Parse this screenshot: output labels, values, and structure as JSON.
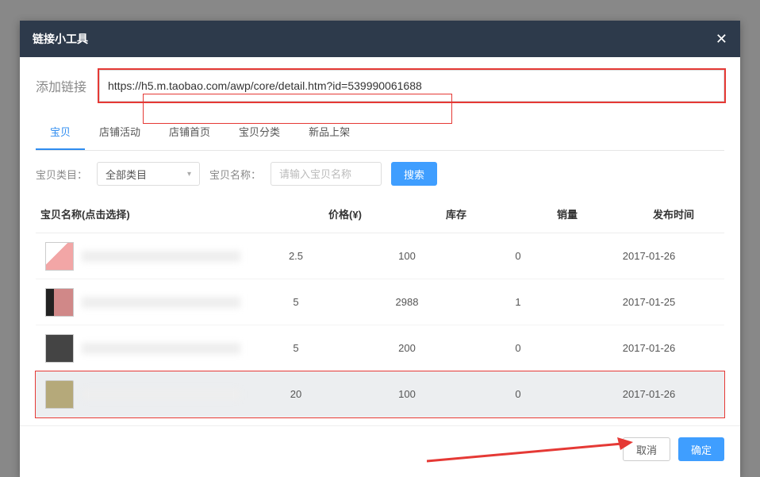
{
  "modal": {
    "title": "链接小工具"
  },
  "addLink": {
    "label": "添加链接",
    "value": "https://h5.m.taobao.com/awp/core/detail.htm?id=539990061688"
  },
  "tabs": [
    "宝贝",
    "店铺活动",
    "店铺首页",
    "宝贝分类",
    "新品上架"
  ],
  "activeTab": 0,
  "filters": {
    "categoryLabel": "宝贝类目：",
    "categoryValue": "全部类目",
    "nameLabel": "宝贝名称：",
    "namePlaceholder": "请输入宝贝名称",
    "searchLabel": "搜索"
  },
  "table": {
    "headers": {
      "name": "宝贝名称(点击选择)",
      "price": "价格(¥)",
      "stock": "库存",
      "sales": "销量",
      "date": "发布时间"
    },
    "rows": [
      {
        "price": "2.5",
        "stock": "100",
        "sales": "0",
        "date": "2017-01-26",
        "selected": false
      },
      {
        "price": "5",
        "stock": "2988",
        "sales": "1",
        "date": "2017-01-25",
        "selected": false
      },
      {
        "price": "5",
        "stock": "200",
        "sales": "0",
        "date": "2017-01-26",
        "selected": false
      },
      {
        "price": "20",
        "stock": "100",
        "sales": "0",
        "date": "2017-01-26",
        "selected": true
      }
    ]
  },
  "footer": {
    "cancel": "取消",
    "confirm": "确定"
  }
}
